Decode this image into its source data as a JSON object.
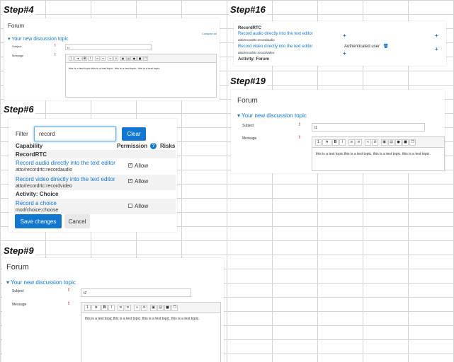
{
  "steps": {
    "step4": "Step#4",
    "step16": "Step#16",
    "step19": "Step#19",
    "step6": "Step#6",
    "step9": "Step#9"
  },
  "forum_form": {
    "title": "Forum",
    "section": "Your new discussion topic",
    "collapse_all": "Collapse all",
    "subject_label": "Subject",
    "subject_value": "t1",
    "message_label": "Message",
    "message_text": "this is a test topic.this is a test topic. this is a test topic. this is a test topic."
  },
  "step9_form": {
    "subject_value": "t2",
    "message_text": "this is a test topic.this is a test topic. this is a test topic. this is a test topic."
  },
  "step19_form": {
    "subject_value": "t1",
    "message_text": "this is a test topic.this is a test topic. this is a test topic. this is a test topic."
  },
  "toolbar_icons": [
    "font-size-icon",
    "paragraph-icon",
    "bold-icon",
    "italic-icon",
    "unordered-list-icon",
    "ordered-list-icon",
    "link-icon",
    "unlink-icon",
    "image-icon",
    "media-icon",
    "record-audio-icon",
    "record-video-icon",
    "manage-files-icon"
  ],
  "permissions": {
    "filter_label": "Filter",
    "filter_value": "record",
    "clear_button": "Clear",
    "col_capability": "Capability",
    "col_permission": "Permission",
    "col_risks": "Risks",
    "group1": "RecordRTC",
    "rows": [
      {
        "name": "Record audio directly into the text editor",
        "code": "atto/recordrtc:recordaudio",
        "permission": "Allow",
        "checked": true
      },
      {
        "name": "Record video directly into the text editor",
        "code": "atto/recordrtc:recordvideo",
        "permission": "Allow",
        "checked": true
      },
      {
        "name": "Record a choice",
        "code": "mod/choice:choose",
        "permission": "Allow",
        "checked": false
      }
    ],
    "group2": "Activity: Choice",
    "save_button": "Save changes",
    "cancel_button": "Cancel"
  },
  "step16": {
    "group": "RecordRTC",
    "row1_name": "Record audio directly into the text editor",
    "row1_code": "atto/recordrtc:recordaudio",
    "row2_name": "Record video directly into the text editor",
    "row2_code": "atto/recordrtc:recordvideo",
    "role": "Authenticated user",
    "group2": "Activity: Forum"
  }
}
